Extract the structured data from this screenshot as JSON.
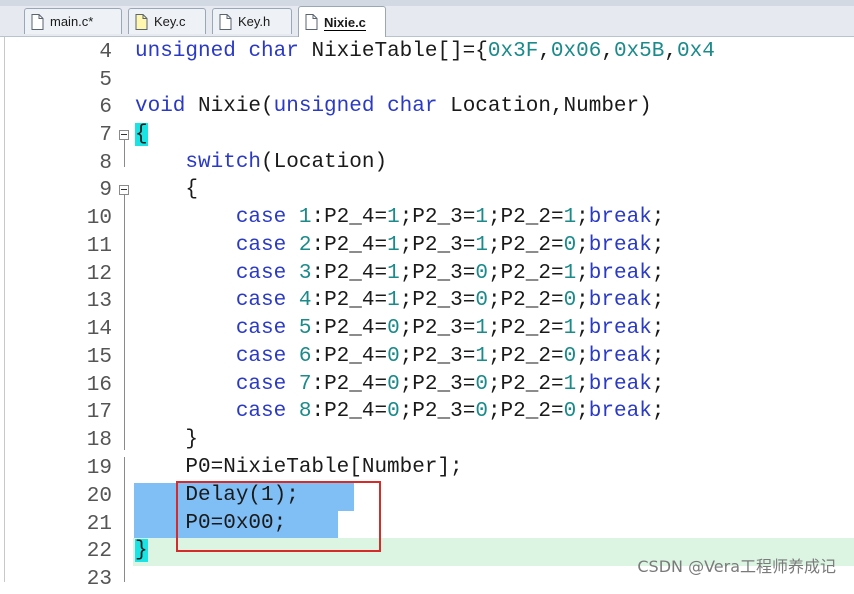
{
  "tabs": [
    {
      "label": "main.c*",
      "active": false
    },
    {
      "label": "Key.c",
      "active": false
    },
    {
      "label": "Key.h",
      "active": false
    },
    {
      "label": "Nixie.c",
      "active": true
    }
  ],
  "editor": {
    "lines": [
      {
        "num": "4"
      },
      {
        "num": "5"
      },
      {
        "num": "6"
      },
      {
        "num": "7"
      },
      {
        "num": "8"
      },
      {
        "num": "9"
      },
      {
        "num": "10"
      },
      {
        "num": "11"
      },
      {
        "num": "12"
      },
      {
        "num": "13"
      },
      {
        "num": "14"
      },
      {
        "num": "15"
      },
      {
        "num": "16"
      },
      {
        "num": "17"
      },
      {
        "num": "18"
      },
      {
        "num": "19"
      },
      {
        "num": "20"
      },
      {
        "num": "21"
      },
      {
        "num": "22"
      },
      {
        "num": "23"
      }
    ],
    "code": {
      "l4": [
        "unsigned",
        " ",
        "char",
        " NixieTable[]={",
        "0x3F",
        ",",
        "0x06",
        ",",
        "0x5B",
        ",",
        "0x4"
      ],
      "l6": [
        "void",
        " Nixie(",
        "unsigned",
        " ",
        "char",
        " Location,Number)"
      ],
      "l7": "{",
      "l8": [
        "    ",
        "switch",
        "(Location)"
      ],
      "l9": "    {",
      "cases": [
        {
          "n": "1",
          "a": "1",
          "b": "1",
          "c": "1"
        },
        {
          "n": "2",
          "a": "1",
          "b": "1",
          "c": "0"
        },
        {
          "n": "3",
          "a": "1",
          "b": "0",
          "c": "1"
        },
        {
          "n": "4",
          "a": "1",
          "b": "0",
          "c": "0"
        },
        {
          "n": "5",
          "a": "0",
          "b": "1",
          "c": "1"
        },
        {
          "n": "6",
          "a": "0",
          "b": "1",
          "c": "0"
        },
        {
          "n": "7",
          "a": "0",
          "b": "0",
          "c": "1"
        },
        {
          "n": "8",
          "a": "0",
          "b": "0",
          "c": "0"
        }
      ],
      "case_kw": "case",
      "break_kw": "break",
      "l18": "    }",
      "l19": "    P0=NixieTable[Number];",
      "l20": [
        "    Delay(",
        "1",
        ");"
      ],
      "l21": [
        "    P0=",
        "0x00",
        ";"
      ],
      "l22": "}"
    }
  },
  "watermark": "CSDN @Vera工程师养成记",
  "colors": {
    "keyword": "#2a3ac7",
    "number": "#1a8a8a",
    "selection": "#7fbff5",
    "annotation_box": "#d62b2b"
  }
}
